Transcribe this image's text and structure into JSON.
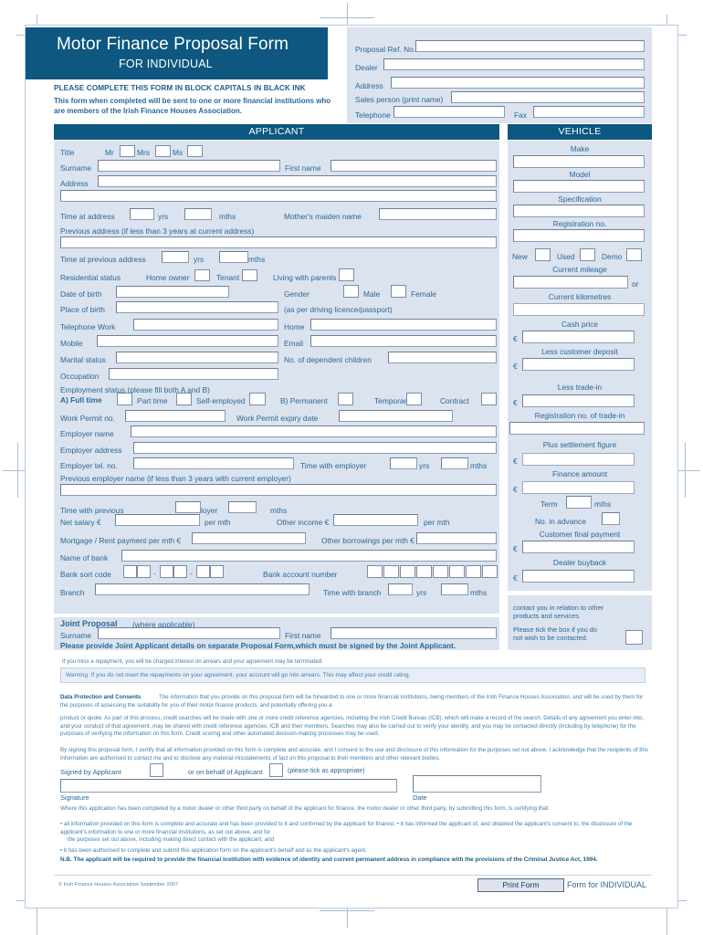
{
  "header": {
    "title": "Motor Finance Proposal Form",
    "subtitle": "FOR INDIVIDUAL",
    "instruction_bold": "PLEASE COMPLETE THIS FORM IN BLOCK CAPITALS IN BLACK INK",
    "instruction_body": "This form when completed will be sent to one or more financial institutions who are members of the Irish Finance Houses Association."
  },
  "dealer": {
    "proposal_ref_label": "Proposal Ref. No.",
    "dealer_label": "Dealer",
    "address_label": "Address",
    "sales_person_label": "Sales person (print name)",
    "telephone_label": "Telephone",
    "fax_label": "Fax",
    "proposal_ref_value": "",
    "dealer_value": "",
    "address_value": "",
    "sales_person_value": "",
    "telephone_value": "",
    "fax_value": ""
  },
  "sections": {
    "applicant": "APPLICANT",
    "vehicle": "VEHICLE"
  },
  "applicant": {
    "title_label": "Title",
    "title_mr": "Mr",
    "title_mrs": "Mrs",
    "title_ms": "Ms",
    "surname_label": "Surname",
    "first_name_label": "First name",
    "address_label": "Address",
    "time_at_address_label": "Time at address",
    "yrs": "yrs",
    "mths": "mths",
    "mothers_maiden_label": "Mother's maiden name",
    "previous_address_label": "Previous address (if less than 3 years at current address)",
    "time_at_previous_label": "Time at previous address",
    "residential_status_label": "Residential status",
    "home_owner": "Home owner",
    "tenant": "Tenant",
    "living_with_parents": "Living with parents",
    "dob_label": "Date of birth",
    "gender_label": "Gender",
    "male": "Male",
    "female": "Female",
    "place_of_birth_label": "Place of birth",
    "passport_note": "(as per driving licence/passport)",
    "telephone_work_label": "Telephone   Work",
    "home_label": "Home",
    "mobile_label": "Mobile",
    "email_label": "Email",
    "marital_status_label": "Marital status",
    "dependent_children_label": "No. of dependent children",
    "occupation_label": "Occupation",
    "employment_status_label": "Employment   status   (please   fill   both   A   and   B)",
    "a_full_time": "A) Full time",
    "part_time": "Part time",
    "self_employed": "Self-employed",
    "b_permanent": "B)    Permanent",
    "temporary": "Temporary",
    "contract": "Contract",
    "work_permit_no_label": "Work Permit no.",
    "work_permit_expiry_label": "Work Permit expiry date",
    "employer_name_label": "Employer name",
    "employer_address_label": "Employer address",
    "employer_tel_label": "Employer tel. no.",
    "time_with_employer_label": "Time with employer",
    "previous_employer_label": "Previous employer name (if less than 3 years with current employer)",
    "time_with_previous_1": "Time       with       previous",
    "time_with_previous_2": "loyer",
    "net_salary_label": "Net salary €",
    "per_mth": "per mth",
    "other_income_label": "Other income €",
    "mortgage_rent_label": "Mortgage / Rent payment per mth €",
    "other_borrowings_label": "Other borrowings per mth €",
    "name_of_bank_label": "Name of bank",
    "bank_sort_code_label": "Bank sort code",
    "bank_account_number_label": "Bank account number",
    "branch_label": "Branch",
    "time_with_branch_label": "Time with branch"
  },
  "joint": {
    "heading": "Joint    Proposal",
    "heading_note": "(where    applicable)",
    "surname_label": "Surname",
    "first_name_label": "First name",
    "notice": "Please provide Joint Applicant details on separate Proposal Form,which must be signed by the Joint Applicant."
  },
  "vehicle": {
    "make": "Make",
    "model": "Model",
    "specification": "Specification",
    "registration_no": "Registration no.",
    "new": "New",
    "used": "Used",
    "demo": "Demo",
    "current_mileage": "Current mileage",
    "or": "or",
    "current_kilometres": "Current kilometres",
    "cash_price": "Cash price",
    "less_customer_deposit": "Less customer deposit",
    "less_trade_in": "Less trade-in",
    "registration_no_trade_in": "Registration no. of trade-in",
    "plus_settlement_figure": "Plus settlement figure",
    "finance_amount": "Finance amount",
    "term": "Term",
    "mths": "mths",
    "no_in_advance": "No. in advance",
    "customer_final_payment": "Customer final payment",
    "dealer_buyback": "Dealer buyback",
    "euro": "€"
  },
  "contact": {
    "line1": "contact you in relation to other",
    "line2": "products and services.",
    "line3": "Please tick the box if you do",
    "line4": "not wish to be contacted."
  },
  "legal": {
    "arrears_note": "If you miss a repayment, you will be charged interest on arrears and your agreement may be terminated.",
    "warning": "Warning: If you do not meet the repayments on your agreement, your account will go into arrears. This may affect your credit rating.",
    "dp_heading": "Data Protection and Consents",
    "dp_p1": "The information that you provide on this proposal form will be forwarded to one or more financial institutions, being members of the Irish Finance Houses Association, and will be used by them for the purposes of assessing the suitability for you of their motor finance products, and potentially offering you a",
    "dp_p2": "product or quote. As part of this process, credit searches will be made with one or more credit reference agencies, including the Irish Credit Bureau (ICB), which will make a record of the search. Details of any agreement you enter into, and your conduct of that agreement, may be shared with credit reference agencies, ICB and their members. Searches may also be carried out to verify your identity, and you may be contacted directly (including by telephone) for the purposes of verifying the information on this form. Credit scoring and other automated decision-making processes may be used.",
    "sign_p1": "By signing this proposal form, I certify that all information provided on this form is complete and accurate, and I consent to the use and disclosure of this information for the purposes set out above. I acknowledge that the recipients of this information are authorised to contact me and to disclose any material misstatements of fact on this proposal to their members and other relevant bodies.",
    "signed_by_applicant": "Signed by Applicant",
    "or_on_behalf": "or on behalf of Applicant",
    "tick_as_appropriate": "(please tick as appropriate)",
    "signature_label": "Signature",
    "date_label": "Date",
    "dealer_p1": "Where this application has been completed by a motor dealer or other third party on behalf of the applicant for finance, the motor dealer or other third party, by submitting this form, is certifying that:",
    "dealer_p2": "• all information provided on this form is complete and accurate and has been provided to it and confirmed by the applicant for finance; • it has informed the applicant of, and obtained the applicant's consent to, the disclosure of the applicant's information to one or more financial institutions, as set out above, and for",
    "dealer_p3": "the purposes set out above, including making direct contact with the applicant; and",
    "dealer_p4": "• it has been authorised to complete and submit this application form on the applicant's behalf and as the applicant's agent.",
    "dealer_nb": "N.B. The applicant will be required to provide the financial institution with evidence of identity and current permanent address in compliance with the provisions of the Criminal Justice Act, 1994."
  },
  "footer": {
    "copyright": "© Irish Finance Houses Association September 2007",
    "print_button": "Print Form",
    "form_for": "Form for INDIVIDUAL"
  },
  "colors": {
    "header_blue": "#0d5780",
    "panel_blue": "#dbe3ef",
    "text_blue": "#2a6898",
    "legal_blue": "#3e7fb0"
  }
}
